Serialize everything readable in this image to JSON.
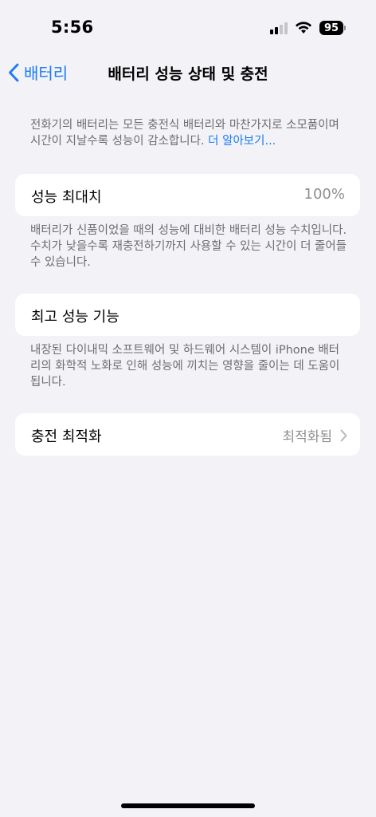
{
  "status_bar": {
    "time": "5:56",
    "battery_level": "95",
    "icons": [
      "cellular-signal-icon",
      "wifi-icon",
      "battery-icon"
    ]
  },
  "nav": {
    "back_label": "배터리",
    "title": "배터리 성능 상태 및 충전"
  },
  "intro": {
    "text_line1": "전화기의 배터리는 모든 충전식 배터리와 마찬가지로 소모품이며",
    "text_line2": "시간이 지날수록 성능이 감소합니다. ",
    "link": "더 알아보기..."
  },
  "max_capacity": {
    "label": "성능 최대치",
    "value": "100%",
    "description": "배터리가 신품이었을 때의 성능에 대비한 배터리 성능 수치입니다. 수치가 낮을수록 재충전하기까지 사용할 수 있는 시간이 더 줄어들 수 있습니다."
  },
  "peak_performance": {
    "label": "최고 성능 기능",
    "description": "내장된 다이내믹 소프트웨어 및 하드웨어 시스템이 iPhone 배터리의 화학적 노화로 인해 성능에 끼치는 영향을 줄이는 데 도움이 됩니다."
  },
  "charging_optimization": {
    "label": "충전 최적화",
    "value": "최적화됨"
  },
  "colors": {
    "background": "#f2f2f7",
    "accent": "#1a7cf5",
    "secondary_text": "#6d6d72"
  }
}
